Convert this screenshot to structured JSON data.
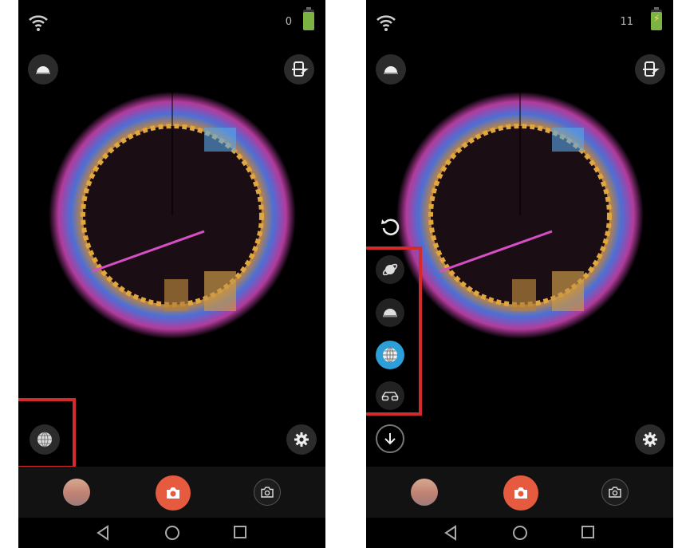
{
  "screens": [
    {
      "id": "left",
      "status": {
        "count": "0",
        "wifi_icon": "wifi-icon",
        "battery_icon": "battery-icon"
      },
      "top_left_button": "dome-view-icon",
      "top_right_button": "screen-rotate-icon",
      "view_mode_button": "globe-icon",
      "settings_button": "gear-icon",
      "bottom_bar": {
        "gallery_thumb": "gallery-thumbnail",
        "shutter": "camera-icon",
        "photo_mode": "camera-outline-icon"
      },
      "nav": [
        "back-icon",
        "home-icon",
        "recents-icon"
      ]
    },
    {
      "id": "right",
      "status": {
        "count": "11",
        "wifi_icon": "wifi-icon",
        "battery_icon": "battery-charging-icon"
      },
      "top_left_button": "dome-view-icon",
      "top_right_button": "screen-rotate-icon",
      "view_mode_menu": [
        "rotate-reset-icon",
        "little-planet-icon",
        "dome-icon",
        "globe-icon",
        "vr-glasses-icon",
        "collapse-arrow-icon"
      ],
      "selected_mode": "globe-icon",
      "settings_button": "gear-icon",
      "bottom_bar": {
        "gallery_thumb": "gallery-thumbnail",
        "shutter": "camera-icon",
        "photo_mode": "camera-outline-icon"
      },
      "nav": [
        "back-icon",
        "home-icon",
        "recents-icon"
      ]
    }
  ],
  "colors": {
    "highlight": "#d32b2b",
    "shutter": "#e65a3f",
    "selected_mode": "#2d9fd8",
    "background": "#000000"
  }
}
